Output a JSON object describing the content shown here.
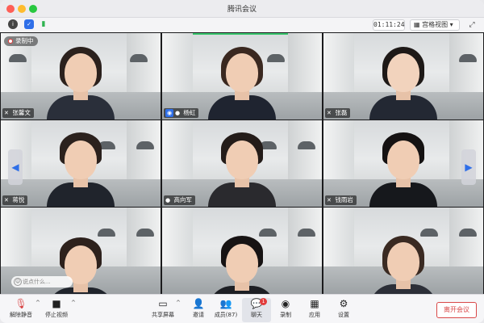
{
  "window": {
    "title": "腾讯会议"
  },
  "toolbar": {
    "timer": "01:11:24",
    "view_label": "宫格视图"
  },
  "recording": {
    "label": "录制中"
  },
  "participants": [
    {
      "name": "张馨文",
      "mic": "muted",
      "host": false
    },
    {
      "name": "杨虹",
      "mic": "on",
      "host": true
    },
    {
      "name": "张磊",
      "mic": "muted",
      "host": false
    },
    {
      "name": "蒋悦",
      "mic": "muted",
      "host": false
    },
    {
      "name": "高向军",
      "mic": "on",
      "host": false
    },
    {
      "name": "钱雨岩",
      "mic": "muted",
      "host": false
    },
    {
      "name": "",
      "mic": "none",
      "host": false
    },
    {
      "name": "",
      "mic": "none",
      "host": false
    },
    {
      "name": "",
      "mic": "none",
      "host": false
    }
  ],
  "chat": {
    "placeholder": "说点什么..."
  },
  "bottom": {
    "unmute": "解除静音",
    "stop_video": "停止视频",
    "share": "共享屏幕",
    "invite": "邀请",
    "members": "成员(87)",
    "chat": "聊天",
    "chat_badge": "1",
    "record": "录制",
    "apps": "应用",
    "settings": "设置",
    "leave": "离开会议"
  },
  "colors": {
    "accent": "#2f6fe8",
    "danger": "#d94848",
    "speaker": "#37c46b"
  }
}
